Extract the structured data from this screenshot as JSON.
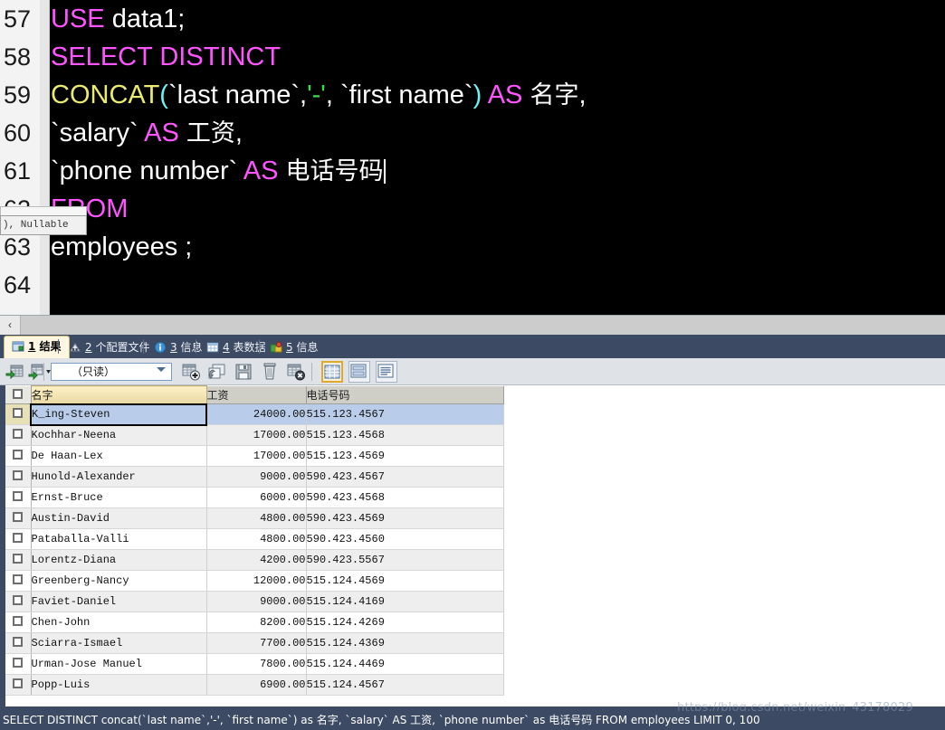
{
  "editor": {
    "lines": [
      {
        "num": "57",
        "parts": [
          {
            "t": "USE ",
            "c": "kw"
          },
          {
            "t": "data1;",
            "c": "idq"
          }
        ]
      },
      {
        "num": "58",
        "parts": [
          {
            "t": "SELECT DISTINCT",
            "c": "kw"
          }
        ]
      },
      {
        "num": "59",
        "parts": [
          {
            "t": "  ",
            "c": "idq"
          },
          {
            "t": "CONCAT",
            "c": "fn"
          },
          {
            "t": "(",
            "c": "par"
          },
          {
            "t": "`last name`",
            "c": "idq"
          },
          {
            "t": ",",
            "c": "comma"
          },
          {
            "t": "'-'",
            "c": "str"
          },
          {
            "t": ", ",
            "c": "comma"
          },
          {
            "t": "`first name`",
            "c": "idq"
          },
          {
            "t": ")",
            "c": "par"
          },
          {
            "t": " AS ",
            "c": "kw"
          },
          {
            "t": "名字",
            "c": "cjk"
          },
          {
            "t": ",",
            "c": "comma"
          }
        ]
      },
      {
        "num": "60",
        "parts": [
          {
            "t": "   ",
            "c": "idq"
          },
          {
            "t": "`salary`",
            "c": "idq"
          },
          {
            "t": " AS ",
            "c": "kw"
          },
          {
            "t": "工资",
            "c": "cjk"
          },
          {
            "t": ",",
            "c": "comma"
          }
        ]
      },
      {
        "num": "61",
        "parts": [
          {
            "t": "   ",
            "c": "idq"
          },
          {
            "t": "`phone number`",
            "c": "idq"
          },
          {
            "t": "  AS  ",
            "c": "kw"
          },
          {
            "t": "电话号码",
            "c": "cjk"
          }
        ],
        "caret": true
      },
      {
        "num": "62",
        "parts": [
          {
            "t": "FROM",
            "c": "kw"
          }
        ]
      },
      {
        "num": "63",
        "parts": [
          {
            "t": "   employees ;",
            "c": "idq"
          }
        ]
      },
      {
        "num": "64",
        "parts": []
      }
    ],
    "tooltip": "), Nullable"
  },
  "scrollbar": {
    "left_arrow": "‹"
  },
  "tabs": [
    {
      "num": "1",
      "label": "结果",
      "icon": "results-grid-icon",
      "active": true
    },
    {
      "num": "2",
      "label": "个配置文件",
      "icon": "profile-icon",
      "active": false
    },
    {
      "num": "3",
      "label": "信息",
      "icon": "info-icon",
      "active": false
    },
    {
      "num": "4",
      "label": "表数据",
      "icon": "table-data-icon",
      "active": false
    },
    {
      "num": "5",
      "label": "信息",
      "icon": "status-icon",
      "active": false
    }
  ],
  "toolbar": {
    "readonly_value": "（只读）",
    "buttons": [
      {
        "name": "apply-changes-icon",
        "title": "apply"
      },
      {
        "name": "apply-menu-icon",
        "title": "apply-menu"
      },
      {
        "name": "add-record-icon",
        "title": "add"
      },
      {
        "name": "import-record-icon",
        "title": "import"
      },
      {
        "name": "save-record-icon",
        "title": "save"
      },
      {
        "name": "delete-record-icon",
        "title": "delete"
      },
      {
        "name": "cancel-record-icon",
        "title": "cancel"
      }
    ],
    "views": [
      {
        "name": "grid-view-icon",
        "active": true
      },
      {
        "name": "form-view-icon",
        "active": false
      },
      {
        "name": "text-view-icon",
        "active": false
      }
    ]
  },
  "grid": {
    "columns": [
      {
        "key": "name",
        "label": "名字",
        "highlight": true,
        "align": "left"
      },
      {
        "key": "sal",
        "label": "工资",
        "highlight": false,
        "align": "right"
      },
      {
        "key": "phone",
        "label": "电话号码",
        "highlight": false,
        "align": "left"
      }
    ],
    "rows": [
      {
        "name": "K_ing-Steven",
        "sal": "24000.00",
        "phone": "515.123.4567",
        "selected": true
      },
      {
        "name": "Kochhar-Neena",
        "sal": "17000.00",
        "phone": "515.123.4568",
        "selected": false
      },
      {
        "name": "De Haan-Lex",
        "sal": "17000.00",
        "phone": "515.123.4569",
        "selected": false
      },
      {
        "name": "Hunold-Alexander",
        "sal": "9000.00",
        "phone": "590.423.4567",
        "selected": false
      },
      {
        "name": "Ernst-Bruce",
        "sal": "6000.00",
        "phone": "590.423.4568",
        "selected": false
      },
      {
        "name": "Austin-David",
        "sal": "4800.00",
        "phone": "590.423.4569",
        "selected": false
      },
      {
        "name": "Pataballa-Valli",
        "sal": "4800.00",
        "phone": "590.423.4560",
        "selected": false
      },
      {
        "name": "Lorentz-Diana",
        "sal": "4200.00",
        "phone": "590.423.5567",
        "selected": false
      },
      {
        "name": "Greenberg-Nancy",
        "sal": "12000.00",
        "phone": "515.124.4569",
        "selected": false
      },
      {
        "name": "Faviet-Daniel",
        "sal": "9000.00",
        "phone": "515.124.4169",
        "selected": false
      },
      {
        "name": "Chen-John",
        "sal": "8200.00",
        "phone": "515.124.4269",
        "selected": false
      },
      {
        "name": "Sciarra-Ismael",
        "sal": "7700.00",
        "phone": "515.124.4369",
        "selected": false
      },
      {
        "name": "Urman-Jose Manuel",
        "sal": "7800.00",
        "phone": "515.124.4469",
        "selected": false
      },
      {
        "name": "Popp-Luis",
        "sal": "6900.00",
        "phone": "515.124.4567",
        "selected": false
      }
    ]
  },
  "status": {
    "query": "SELECT DISTINCT concat(`last name`,'-', `first name`) as 名字, `salary` AS 工资, `phone number`  as 电话号码 FROM employees LIMIT 0, 100"
  },
  "watermark": {
    "text": "https://blog.csdn.net/weixin_43178029"
  },
  "colors": {
    "editor_bg": "#000000",
    "keyword": "#ff55ff",
    "function": "#eaea72",
    "paren": "#6ff2f2",
    "string": "#36e04a",
    "chrome": "#3c4a63",
    "tab_active_bg": "#fdf6e0",
    "row_selected": "#b9cdea",
    "header_highlight": "#e9d9a2"
  }
}
